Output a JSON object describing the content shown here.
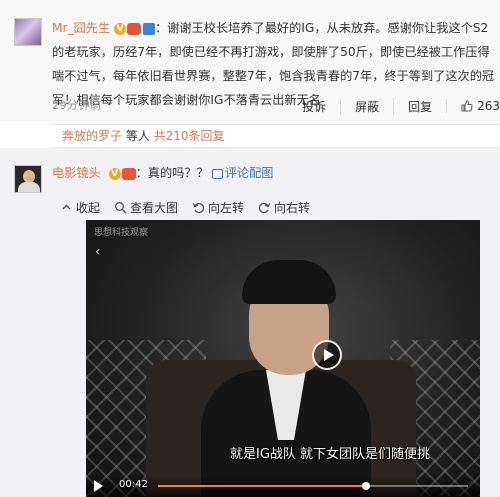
{
  "comment1": {
    "username": "Mr_囧先生",
    "text": "：谢谢王校长培养了最好的IG，从未放弃。感谢你让我这个S2的老玩家，历经7年，即使已经不再打游戏，即使胖了50斤，即使已经被工作压得喘不过气，每年依旧看世界赛，整整7年，饱含我青春的7年，终于等到了这次的冠军！相信每个玩家都会谢谢你IG不落青云出新无名",
    "time": "29分钟前",
    "actions": [
      "投诉",
      "屏蔽",
      "回复"
    ],
    "likes": "263"
  },
  "replies_bar": {
    "name": "奔放的罗子",
    "middle": " 等人 ",
    "count": "共210条回复"
  },
  "comment2": {
    "username": "电影镜头",
    "text": "：真的吗？？",
    "review_link": "评论配图",
    "toolbar": {
      "collect": "收起",
      "view_large": "查看大图",
      "rotate_left": "向左转",
      "rotate_right": "向右转"
    }
  },
  "video": {
    "watermark": "思想科技观察",
    "subtitle": "就是IG战队  就下女团队是们随便挑",
    "time": "00:42",
    "progress": 0.67
  },
  "colors": {
    "accent_orange": "#eb7350",
    "link_blue": "#3e76b4",
    "progress": "#ff8200"
  }
}
